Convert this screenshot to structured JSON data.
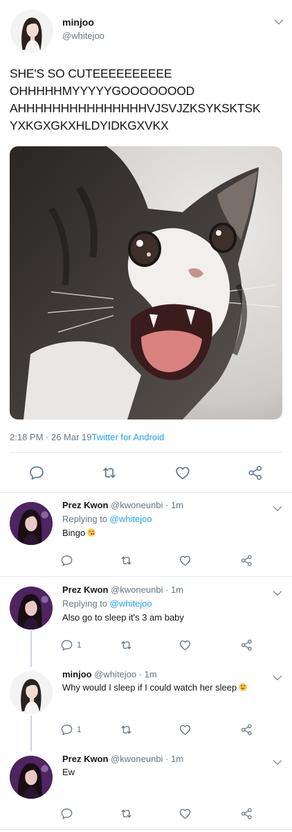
{
  "main_tweet": {
    "name": "minjoo",
    "handle": "@whitejoo",
    "text_lines": [
      "SHE'S SO CUTEEEEEEEEEE",
      "OHHHHHMYYYYYGOOOOOOOD",
      "AHHHHHHHHHHHHHHHVJSVJZKSYKSKTSK",
      "YXKGXGKXHLDYIDKGXVKX"
    ],
    "timestamp": "2:18 PM · 26 Mar 19",
    "source": "Twitter for Android"
  },
  "replies": [
    {
      "name": "Prez Kwon",
      "handle": "@kwoneunbi · 1m",
      "replying_label": "Replying to ",
      "replying_to": "@whitejoo",
      "text": "Bingo",
      "emoji": "kiss-face-emoji",
      "reply_count": ""
    },
    {
      "name": "Prez Kwon",
      "handle": "@kwoneunbi · 1m",
      "replying_label": "Replying to ",
      "replying_to": "@whitejoo",
      "text": "Also go to sleep it's 3 am baby",
      "emoji": "",
      "reply_count": "1"
    },
    {
      "name": "minjoo",
      "handle": "@whitejoo · 1m",
      "text": "Why would I sleep if I could watch her sleep",
      "emoji": "heart-eyes-emoji",
      "reply_count": "1"
    },
    {
      "name": "Prez Kwon",
      "handle": "@kwoneunbi · 1m",
      "text": "Ew",
      "emoji": "",
      "reply_count": ""
    }
  ],
  "icons": {
    "action_color": "#657786",
    "link_color": "#1da1f2"
  }
}
